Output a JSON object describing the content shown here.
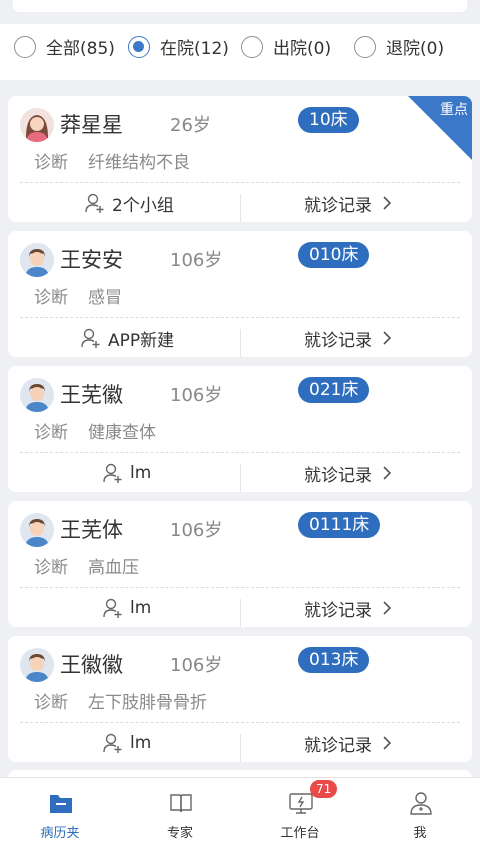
{
  "filters": [
    {
      "label": "全部(85)",
      "checked": false
    },
    {
      "label": "在院(12)",
      "checked": true
    },
    {
      "label": "出院(0)",
      "checked": false
    },
    {
      "label": "退院(0)",
      "checked": false
    }
  ],
  "patients": [
    {
      "name": "莽星星",
      "age": "26岁",
      "bed": "10床",
      "diag_label": "诊断",
      "diagnosis": "纤维结构不良",
      "group": "2个小组",
      "record": "就诊记录",
      "tag": "重点",
      "avatar": "female-avatar-icon"
    },
    {
      "name": "王安安",
      "age": "106岁",
      "bed": "010床",
      "diag_label": "诊断",
      "diagnosis": "感冒",
      "group": "APP新建",
      "record": "就诊记录",
      "avatar": "male-avatar-icon"
    },
    {
      "name": "王芜徽",
      "age": "106岁",
      "bed": "021床",
      "diag_label": "诊断",
      "diagnosis": "健康查体",
      "group": "lm",
      "record": "就诊记录",
      "avatar": "male-avatar-icon"
    },
    {
      "name": "王芜体",
      "age": "106岁",
      "bed": "0111床",
      "diag_label": "诊断",
      "diagnosis": "高血压",
      "group": "lm",
      "record": "就诊记录",
      "avatar": "male-avatar-icon"
    },
    {
      "name": "王徽徽",
      "age": "106岁",
      "bed": "013床",
      "diag_label": "诊断",
      "diagnosis": "左下肢腓骨骨折",
      "group": "lm",
      "record": "就诊记录",
      "avatar": "male-avatar-icon"
    }
  ],
  "tabs": [
    {
      "label": "病历夹",
      "icon": "folder-icon",
      "active": true
    },
    {
      "label": "专家",
      "icon": "book-icon",
      "active": false
    },
    {
      "label": "工作台",
      "icon": "monitor-icon",
      "active": false,
      "badge": "71"
    },
    {
      "label": "我",
      "icon": "user-icon",
      "active": false
    }
  ],
  "colors": {
    "accent": "#2f6dbe",
    "badge": "#e94a4a",
    "background": "#eef0f4"
  }
}
